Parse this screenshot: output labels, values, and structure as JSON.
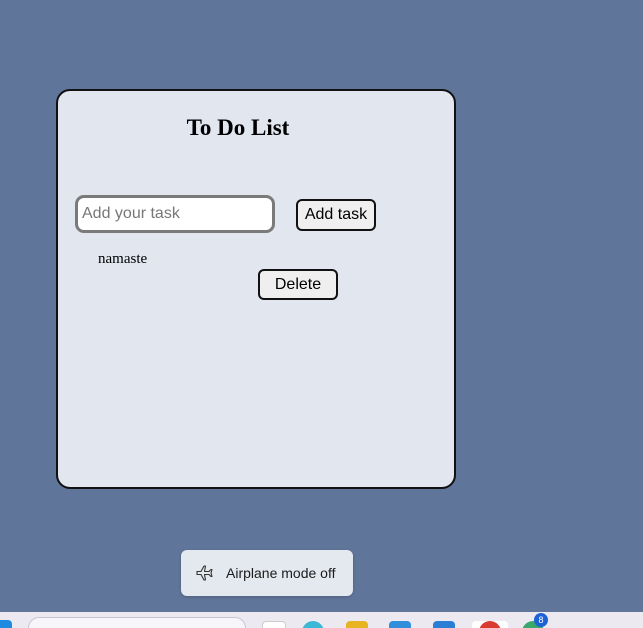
{
  "app": {
    "title": "To Do List",
    "input": {
      "placeholder": "Add your task",
      "value": ""
    },
    "add_button_label": "Add task",
    "tasks": [
      {
        "text": "namaste",
        "delete_label": "Delete"
      }
    ]
  },
  "notification": {
    "icon": "airplane-icon",
    "text": "Airplane mode off"
  },
  "taskbar": {
    "icons": [
      "windows-start-icon",
      "search-box",
      "file-icon",
      "copilot-icon",
      "folder-icon",
      "store-icon",
      "mail-icon",
      "chrome-icon",
      "edge-icon"
    ],
    "badge_count": "8"
  },
  "colors": {
    "background": "#60759a",
    "card": "#e1e6ef"
  }
}
